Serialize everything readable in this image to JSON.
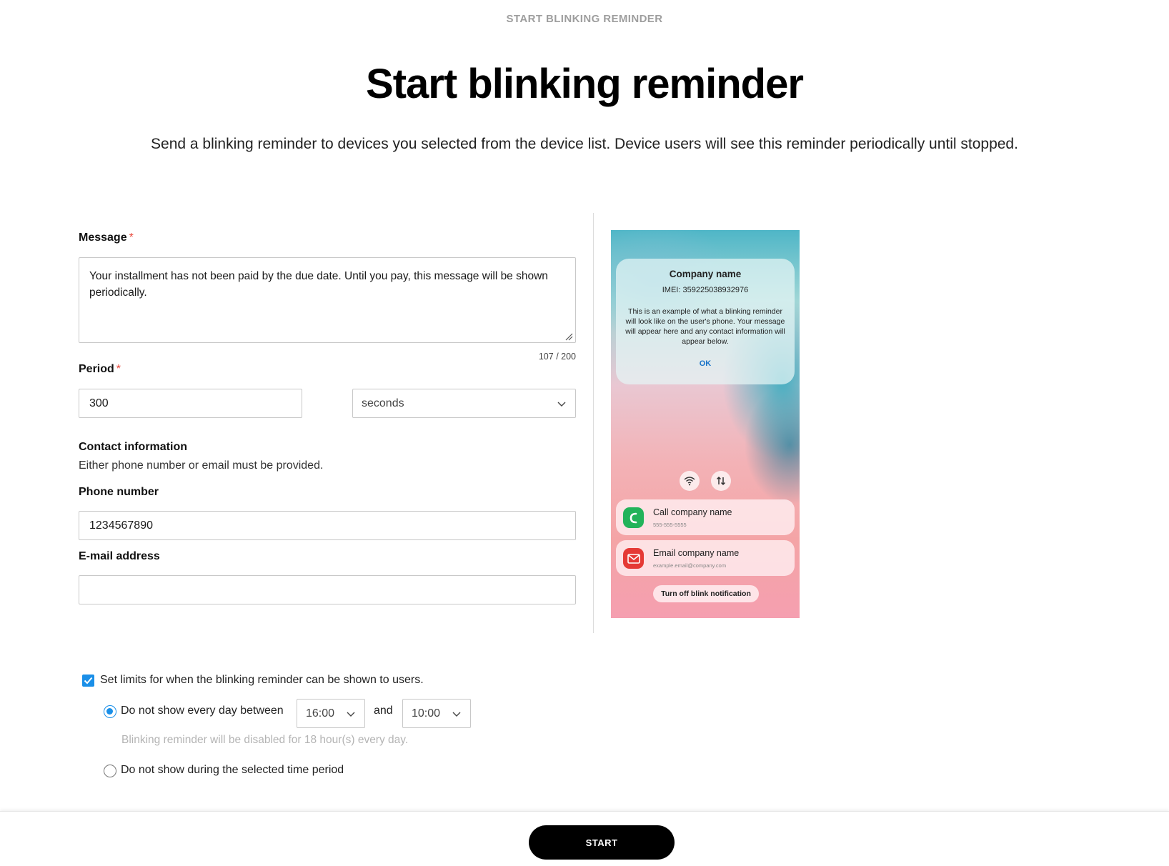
{
  "header": {
    "top_label": "START BLINKING REMINDER",
    "title": "Start blinking reminder",
    "subtitle": "Send a blinking reminder to devices you selected from the device list. Device users will see this reminder periodically until stopped."
  },
  "form": {
    "message": {
      "label": "Message",
      "required_mark": "*",
      "value": "Your installment has not been paid by the due date. Until you pay, this message will be shown periodically.",
      "counter": "107 / 200"
    },
    "period": {
      "label": "Period",
      "required_mark": "*",
      "value": "300",
      "unit": "seconds"
    },
    "contact": {
      "label": "Contact information",
      "helper": "Either phone number or email must be provided."
    },
    "phone": {
      "label": "Phone number",
      "value": "1234567890"
    },
    "email": {
      "label": "E-mail address",
      "value": ""
    }
  },
  "preview": {
    "dialog_title": "Company name",
    "imei": "IMEI: 359225038932976",
    "body": "This is an example of what a blinking reminder will look like on the user's phone. Your message will appear here and any contact information will appear below.",
    "ok": "OK",
    "call_title": "Call company name",
    "call_sub": "555-555-5555",
    "email_title": "Email company name",
    "email_sub": "example.email@company.com",
    "turn_off": "Turn off blink notification"
  },
  "limits": {
    "checkbox_label": "Set limits for when the blinking reminder can be shown to users.",
    "checked": true,
    "option1_label": "Do not show every day between",
    "from_time": "16:00",
    "and": "and",
    "to_time": "10:00",
    "option1_hint": "Blinking reminder will be disabled for 18 hour(s) every day.",
    "option2_label": "Do not show during the selected time period",
    "selected_option": 1
  },
  "footer": {
    "start_label": "START"
  },
  "colors": {
    "accent": "#1a8fe8",
    "required": "#e8473b",
    "primary_button": "#000000"
  }
}
